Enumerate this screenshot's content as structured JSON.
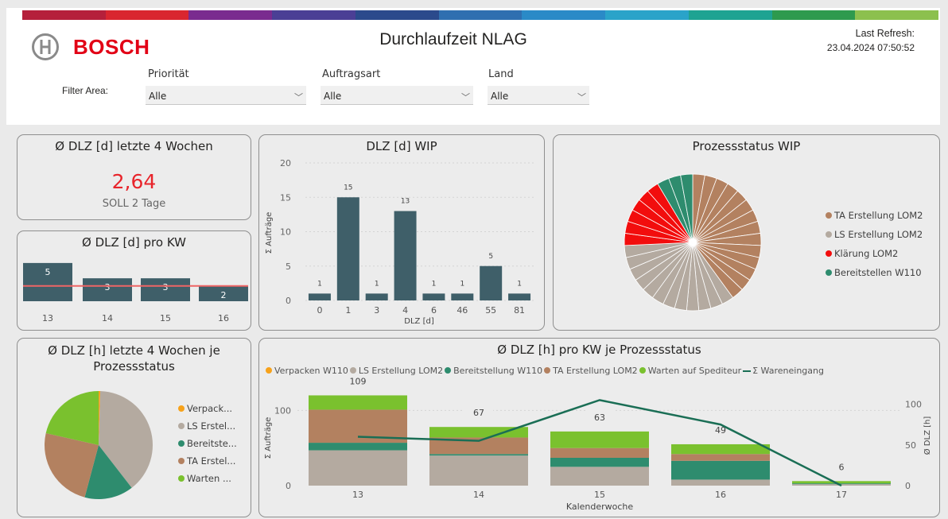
{
  "header": {
    "logo_text": "BOSCH",
    "title": "Durchlaufzeit NLAG",
    "refresh_label": "Last Refresh:",
    "refresh_value": "23.04.2024 07:50:52",
    "filter_area_label": "Filter Area:",
    "rainbow": [
      "#b5203b",
      "#d9262f",
      "#7a2b8f",
      "#4b3f95",
      "#2b4a8c",
      "#2f6fb0",
      "#2a8ac7",
      "#2aa3c9",
      "#1ea392",
      "#2e9a4e",
      "#8cc04e"
    ]
  },
  "filters": [
    {
      "label": "Priorität",
      "value": "Alle"
    },
    {
      "label": "Auftragsart",
      "value": "Alle"
    },
    {
      "label": "Land",
      "value": "Alle"
    }
  ],
  "kpi": {
    "title": "Ø DLZ [d] letzte 4 Wochen",
    "value": "2,64",
    "subtitle": "SOLL 2 Tage",
    "value_color": "#e8242b"
  },
  "colors": {
    "bar": "#3f5f69",
    "ta": "#b38160",
    "ls": "#b4aaa0",
    "klaerung": "#f20d0d",
    "bereit": "#2e8c6e",
    "verpack": "#f7a21b",
    "warten": "#7ac12e",
    "line": "#1a6e55",
    "target": "#ef6565"
  },
  "charts": {
    "kw_dlz": {
      "title": "Ø DLZ [d] pro KW",
      "chart_data": {
        "type": "bar",
        "categories": [
          "13",
          "14",
          "15",
          "16"
        ],
        "values": [
          5,
          3,
          3,
          2
        ],
        "target": 2,
        "ylim": [
          0,
          5.3
        ]
      }
    },
    "wip": {
      "title": "DLZ [d] WIP",
      "chart_data": {
        "type": "bar",
        "categories": [
          "0",
          "1",
          "3",
          "4",
          "6",
          "46",
          "55",
          "81"
        ],
        "values": [
          1,
          15,
          1,
          13,
          1,
          1,
          5,
          1
        ],
        "xlabel": "DLZ [d]",
        "ylabel": "Σ Aufträge",
        "ylim": [
          0,
          20
        ],
        "yticks": [
          "0",
          "5",
          "10",
          "15",
          "20"
        ]
      }
    },
    "status_wip": {
      "title": "Prozessstatus WIP",
      "chart_data": {
        "type": "pie",
        "labels": [
          "TA Erstellung LOM2",
          "LS Erstellung LOM2",
          "Klärung LOM2",
          "Bereitstellen W110"
        ],
        "values": [
          14,
          12,
          6,
          3
        ],
        "legend": "right"
      }
    },
    "status_4w": {
      "title": "Ø DLZ [h] letzte 4 Wochen je Prozessstatus",
      "chart_data": {
        "type": "pie",
        "labels": [
          "Verpack...",
          "LS Erstel...",
          "Bereitste...",
          "TA Erstel...",
          "Warten ..."
        ],
        "values": [
          0.5,
          40,
          15,
          25,
          22
        ],
        "legend": "right"
      }
    },
    "kw_status": {
      "title": "Ø DLZ [h] pro KW je Prozessstatus",
      "legend": [
        "Verpacken W110",
        "LS Erstellung LOM2",
        "Bereitstellung W110",
        "TA Erstellung LOM2",
        "Warten auf Spediteur",
        "Σ Wareneingang"
      ],
      "chart_data": {
        "type": "bar",
        "stacked": true,
        "categories": [
          "13",
          "14",
          "15",
          "16",
          "17"
        ],
        "xlabel": "Kalenderwoche",
        "ylabel": "Σ Aufträge",
        "ylabel_right": "Ø DLZ [h]",
        "ylim": [
          0,
          130
        ],
        "yticks_left": [
          "0",
          "100"
        ],
        "yticks_right": [
          "0",
          "50",
          "100"
        ],
        "series": [
          {
            "name": "Verpacken W110",
            "values": [
              0,
              0,
              0,
              0,
              0
            ]
          },
          {
            "name": "LS Erstellung LOM2",
            "values": [
              47,
              40,
              25,
              8,
              2
            ]
          },
          {
            "name": "Bereitstellung W110",
            "values": [
              10,
              2,
              12,
              25,
              1
            ]
          },
          {
            "name": "TA Erstellung LOM2",
            "values": [
              44,
              22,
              13,
              9,
              0
            ]
          },
          {
            "name": "Warten auf Spediteur",
            "values": [
              19,
              14,
              22,
              13,
              3
            ]
          }
        ],
        "line": {
          "name": "Σ Wareneingang",
          "values": [
            60,
            55,
            105,
            75,
            0
          ]
        },
        "bar_labels": [
          "109",
          "67",
          "63",
          "49",
          "6"
        ]
      }
    }
  }
}
